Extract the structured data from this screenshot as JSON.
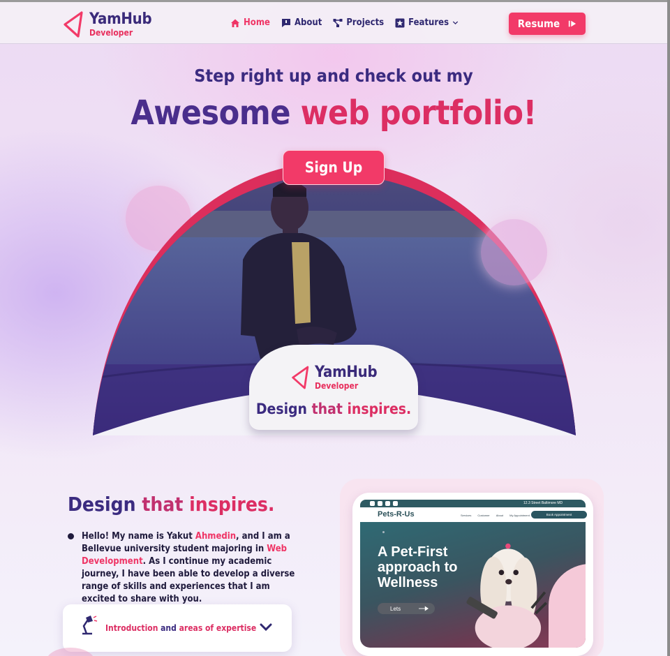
{
  "nav": {
    "logo_name": "YamHub",
    "logo_sub": "Developer",
    "links": [
      {
        "label": "Home",
        "icon": "home-icon"
      },
      {
        "label": "About",
        "icon": "chat-icon"
      },
      {
        "label": "Projects",
        "icon": "network-icon"
      },
      {
        "label": "Features",
        "icon": "star-icon"
      }
    ],
    "resume_label": "Resume"
  },
  "hero": {
    "subtitle": "Step right up and check out my",
    "title_dark": "Awesome",
    "title_pink": "web portfolio!",
    "signup_label": "Sign Up",
    "badge_name": "YamHub",
    "badge_sub": "Developer",
    "badge_tag_1": "Design",
    "badge_tag_2": "that",
    "badge_tag_3": "inspires."
  },
  "about": {
    "title_1": "Design",
    "title_2": "that",
    "title_3": "inspires.",
    "p_1": "Hello! My name is Yakut ",
    "p_name": "Ahmedin",
    "p_2": ", and I am a Bellevue university student majoring in ",
    "p_major": "Web Development",
    "p_3": ". As I continue my academic journey, I have been able to develop a diverse range of skills and experiences that I am excited to share with you.",
    "accordion_1": "Introduction",
    "accordion_2": " and ",
    "accordion_3": "areas of expertise"
  },
  "preview": {
    "address": "12.3 Street Baltimore MD",
    "brand": "Pets-R-Us",
    "links": [
      "Services",
      "Customer",
      "About",
      "My Appointment"
    ],
    "book": "Book Appointment",
    "heading_1": "A Pet-First",
    "heading_2": "approach to",
    "heading_3": "Wellness",
    "button": "Lets"
  },
  "colors": {
    "accent": "#f23a68",
    "brand_dark": "#3b2b80",
    "arch_fill": "#3a2a82"
  }
}
